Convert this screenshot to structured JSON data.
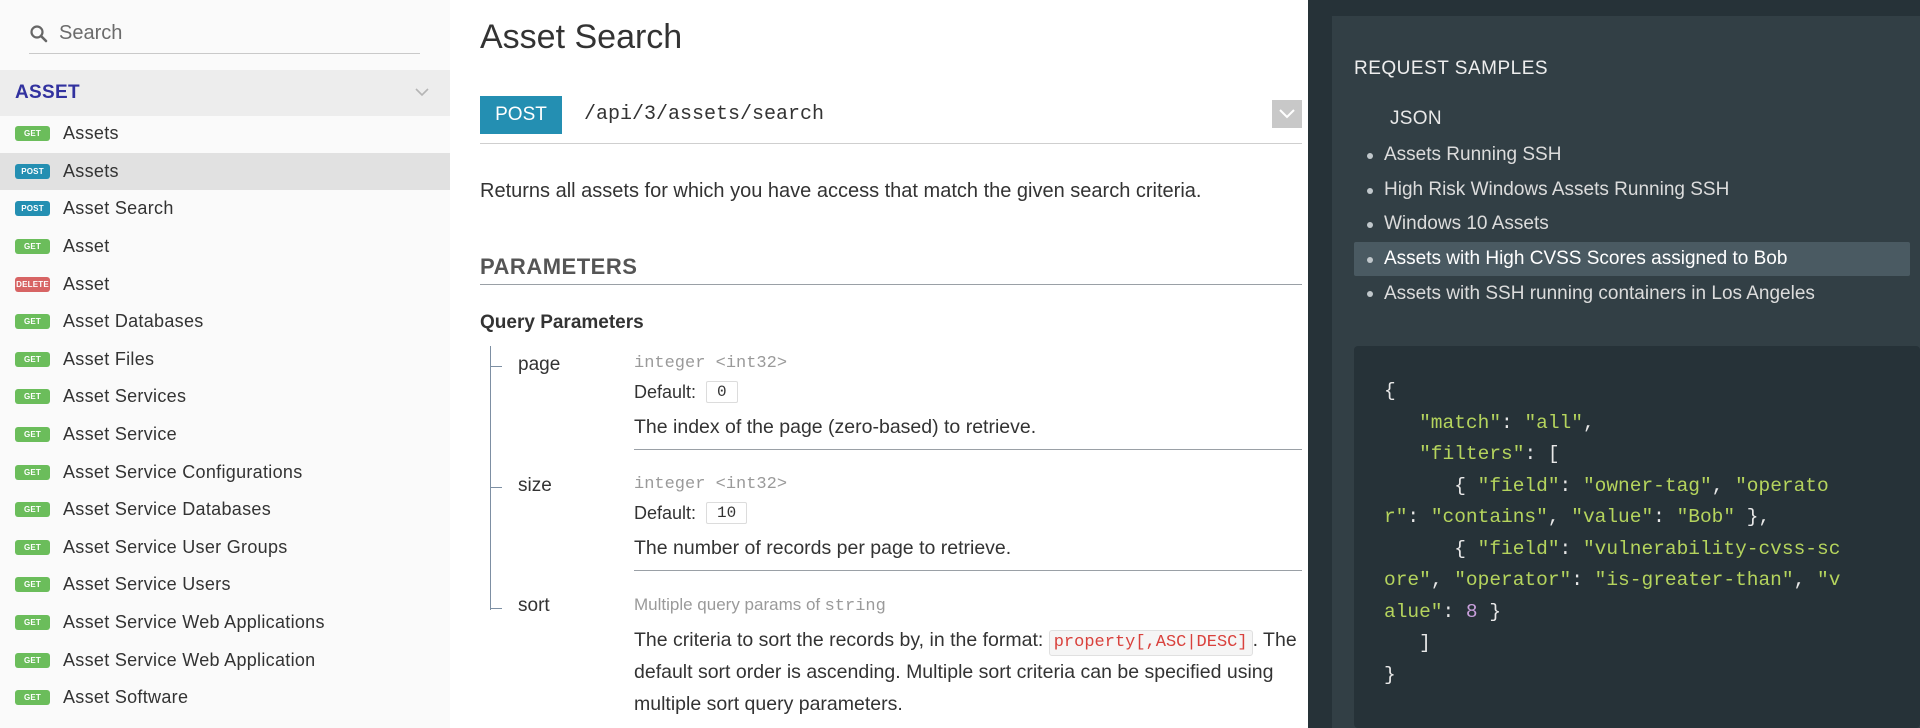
{
  "sidebar": {
    "search_placeholder": "Search",
    "group_title": "ASSET",
    "items": [
      {
        "method": "GET",
        "label": "Assets"
      },
      {
        "method": "POST",
        "label": "Assets"
      },
      {
        "method": "POST",
        "label": "Asset Search"
      },
      {
        "method": "GET",
        "label": "Asset"
      },
      {
        "method": "DELETE",
        "label": "Asset"
      },
      {
        "method": "GET",
        "label": "Asset Databases"
      },
      {
        "method": "GET",
        "label": "Asset Files"
      },
      {
        "method": "GET",
        "label": "Asset Services"
      },
      {
        "method": "GET",
        "label": "Asset Service"
      },
      {
        "method": "GET",
        "label": "Asset Service Configurations"
      },
      {
        "method": "GET",
        "label": "Asset Service Databases"
      },
      {
        "method": "GET",
        "label": "Asset Service User Groups"
      },
      {
        "method": "GET",
        "label": "Asset Service Users"
      },
      {
        "method": "GET",
        "label": "Asset Service Web Applications"
      },
      {
        "method": "GET",
        "label": "Asset Service Web Application"
      },
      {
        "method": "GET",
        "label": "Asset Software"
      }
    ],
    "active_index": 1
  },
  "main": {
    "title": "Asset Search",
    "method": "POST",
    "path": "/api/3/assets/search",
    "description": "Returns all assets for which you have access that match the given search criteria.",
    "parameters_title": "PARAMETERS",
    "query_title": "Query Parameters",
    "default_label": "Default:",
    "params": [
      {
        "name": "page",
        "type": "integer <int32>",
        "default": "0",
        "description": "The index of the page (zero-based) to retrieve."
      },
      {
        "name": "size",
        "type": "integer <int32>",
        "default": "10",
        "description": "The number of records per page to retrieve."
      },
      {
        "name": "sort",
        "type_prefix": "Multiple query params of",
        "type_code": "string",
        "desc_before": "The criteria to sort the records by, in the format:",
        "desc_code": "property[,ASC|DESC]",
        "desc_after": ". The default sort order is ascending. Multiple sort criteria can be specified using multiple sort query parameters."
      }
    ]
  },
  "right": {
    "samples_title": "REQUEST SAMPLES",
    "tab": "JSON",
    "samples": [
      "Assets Running SSH",
      "High Risk Windows Assets Running SSH",
      "Windows 10 Assets",
      "Assets with High CVSS Scores assigned to Bob",
      "Assets with SSH running containers in Los Angeles"
    ],
    "active_sample": 3,
    "code_lines": [
      [
        {
          "t": "p",
          "v": "{"
        }
      ],
      [
        {
          "t": "p",
          "v": "   "
        },
        {
          "t": "s",
          "v": "\"match\""
        },
        {
          "t": "p",
          "v": ": "
        },
        {
          "t": "s",
          "v": "\"all\""
        },
        {
          "t": "p",
          "v": ","
        }
      ],
      [
        {
          "t": "p",
          "v": "   "
        },
        {
          "t": "s",
          "v": "\"filters\""
        },
        {
          "t": "p",
          "v": ": ["
        }
      ],
      [
        {
          "t": "p",
          "v": "      { "
        },
        {
          "t": "s",
          "v": "\"field\""
        },
        {
          "t": "p",
          "v": ": "
        },
        {
          "t": "s",
          "v": "\"owner-tag\""
        },
        {
          "t": "p",
          "v": ", "
        },
        {
          "t": "s",
          "v": "\"operato"
        }
      ],
      [
        {
          "t": "s",
          "v": "r\""
        },
        {
          "t": "p",
          "v": ": "
        },
        {
          "t": "s",
          "v": "\"contains\""
        },
        {
          "t": "p",
          "v": ", "
        },
        {
          "t": "s",
          "v": "\"value\""
        },
        {
          "t": "p",
          "v": ": "
        },
        {
          "t": "s",
          "v": "\"Bob\""
        },
        {
          "t": "p",
          "v": " },"
        }
      ],
      [
        {
          "t": "p",
          "v": "      { "
        },
        {
          "t": "s",
          "v": "\"field\""
        },
        {
          "t": "p",
          "v": ": "
        },
        {
          "t": "s",
          "v": "\"vulnerability-cvss-sc"
        }
      ],
      [
        {
          "t": "s",
          "v": "ore\""
        },
        {
          "t": "p",
          "v": ", "
        },
        {
          "t": "s",
          "v": "\"operator\""
        },
        {
          "t": "p",
          "v": ": "
        },
        {
          "t": "s",
          "v": "\"is-greater-than\""
        },
        {
          "t": "p",
          "v": ", "
        },
        {
          "t": "s",
          "v": "\"v"
        }
      ],
      [
        {
          "t": "s",
          "v": "alue\""
        },
        {
          "t": "p",
          "v": ": "
        },
        {
          "t": "n",
          "v": "8"
        },
        {
          "t": "p",
          "v": " }"
        }
      ],
      [
        {
          "t": "p",
          "v": "   ]"
        }
      ],
      [
        {
          "t": "p",
          "v": "}"
        }
      ]
    ]
  },
  "colors": {
    "get": "#6bbd5b",
    "post": "#248fb2",
    "delete": "#cc3333",
    "accent": "#32329f",
    "panel_dark": "#263238"
  },
  "icons": {
    "search": "search-icon",
    "chevron": "chevron-down-icon"
  }
}
